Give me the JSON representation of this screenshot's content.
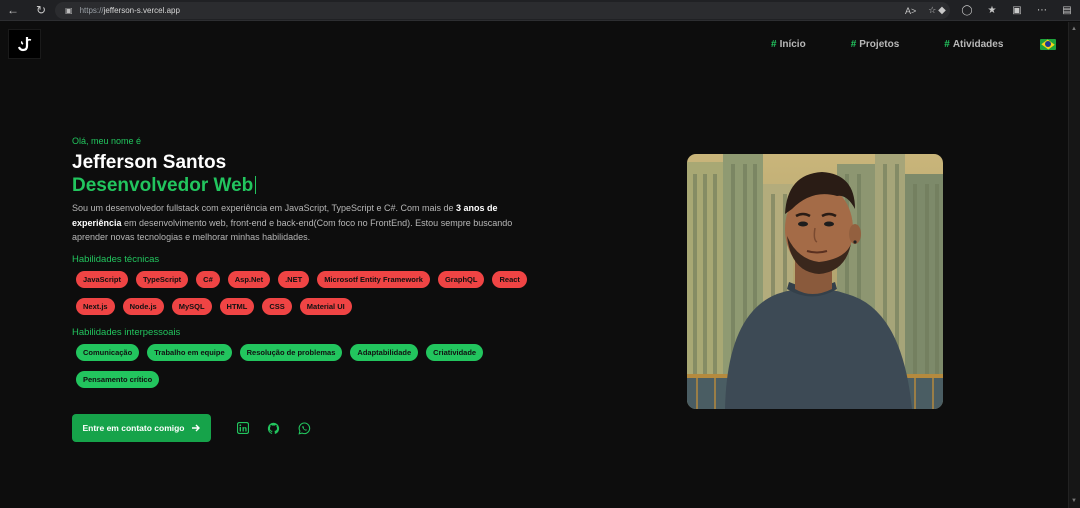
{
  "browser": {
    "url_scheme": "https://",
    "url_host": "jefferson-s.vercel.app"
  },
  "header": {
    "logo_text": "JS",
    "nav": [
      {
        "hash": "#",
        "label": "Início"
      },
      {
        "hash": "#",
        "label": "Projetos"
      },
      {
        "hash": "#",
        "label": "Atividades"
      }
    ],
    "language_flag": "brazil-flag-icon"
  },
  "hero": {
    "greeting": "Olá, meu nome é",
    "name": "Jefferson Santos",
    "role": "Desenvolvedor Web",
    "bio_part1": "Sou um desenvolvedor fullstack com experiência em JavaScript, TypeScript e C#. Com mais de ",
    "bio_highlight": "3 anos de experiência",
    "bio_part2": " em desenvolvimento web, front-end e back-end(Com foco no FrontEnd). Estou sempre buscando aprender novas tecnologias e melhorar minhas habilidades.",
    "tech_label": "Habilidades técnicas",
    "tech_skills": [
      "JavaScript",
      "TypeScript",
      "C#",
      "Asp.Net",
      ".NET",
      "Microsotf Entity Framework",
      "GraphQL",
      "React",
      "Next.js",
      "Node.js",
      "MySQL",
      "HTML",
      "CSS",
      "Material UI"
    ],
    "soft_label": "Habilidades interpessoais",
    "soft_skills": [
      "Comunicação",
      "Trabalho em equipe",
      "Resolução de problemas",
      "Adaptabilidade",
      "Criatividade",
      "Pensamento crítico"
    ],
    "cta_label": "Entre em contato comigo",
    "social_icons": [
      "linkedin-icon",
      "github-icon",
      "whatsapp-icon"
    ]
  },
  "colors": {
    "accent": "#22c55e",
    "tech_chip": "#ef4444",
    "background": "#0d0d0d"
  }
}
